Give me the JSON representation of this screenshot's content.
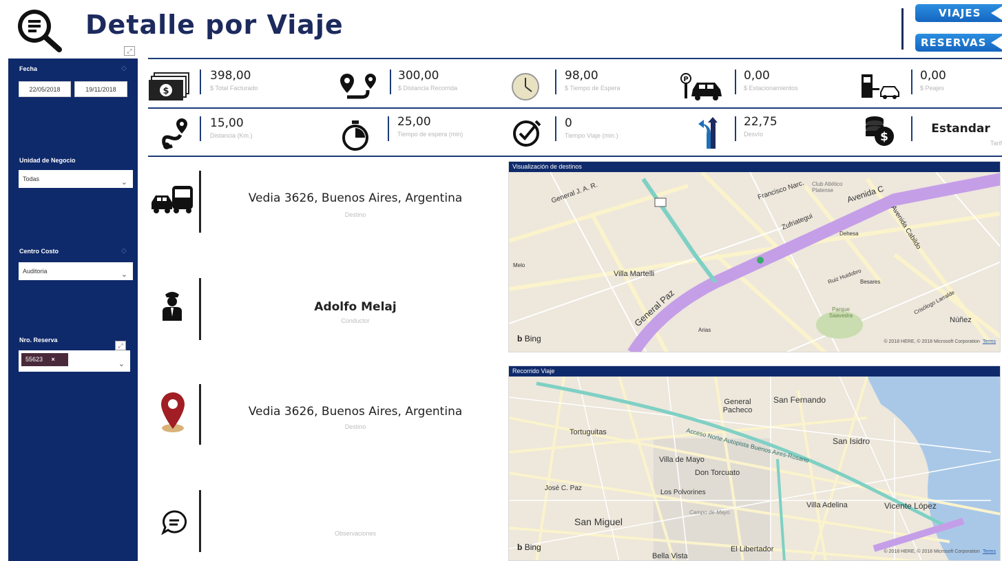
{
  "header": {
    "title": "Detalle por Viaje",
    "nav": {
      "viajes_label": "VIAJES",
      "reservas_label": "RESERVAS"
    }
  },
  "colors": {
    "navy": "#0f2a6b",
    "accent_blue": "#1c3a78",
    "button_blue": "#1f7ad6",
    "tag_bg": "#4a2a3a",
    "route_purple": "#b07be0",
    "pin_red": "#a01e24"
  },
  "sidebar": {
    "fecha_label": "Fecha",
    "date_from": "22/05/2018",
    "date_to": "19/11/2018",
    "unidad_label": "Unidad de Negocio",
    "unidad_value": "Todas",
    "centro_label": "Centro Costo",
    "centro_value": "Auditoria",
    "reserva_label": "Nro. Reserva",
    "reserva_tag": "55623",
    "reserva_tag_remove": "×"
  },
  "kpis_row1": [
    {
      "value": "398,00",
      "label": "$ Total Facturado",
      "icon": "money-icon"
    },
    {
      "value": "300,00",
      "label": "$ Distancia Recorrida",
      "icon": "route-icon"
    },
    {
      "value": "98,00",
      "label": "$ Tiempo de Espera",
      "icon": "clock-icon"
    },
    {
      "value": "0,00",
      "label": "$ Estacionamientos",
      "icon": "parking-icon"
    },
    {
      "value": "0,00",
      "label": "$ Peajes",
      "icon": "toll-icon"
    }
  ],
  "kpis_row2": [
    {
      "value": "15,00",
      "label": "Distancia (Km.)",
      "icon": "distance-icon"
    },
    {
      "value": "25,00",
      "label": "Tiempo de espera (min)",
      "icon": "stopwatch-icon"
    },
    {
      "value": "0",
      "label": "Tiempo Viaje (min.)",
      "icon": "timer-check-icon"
    },
    {
      "value": "22,75",
      "label": "Desvío",
      "icon": "detour-icon"
    },
    {
      "value": "Estandar",
      "label": "Tarifa",
      "icon": "coins-icon"
    }
  ],
  "details": {
    "origen_value": "Vedia 3626, Buenos Aires, Argentina",
    "origen_label": "Destino",
    "conductor_value": "Adolfo Melaj",
    "conductor_label": "Conductor",
    "destino_value": "Vedia 3626, Buenos Aires, Argentina",
    "destino_label": "Destino",
    "obs_label": "Observaciones"
  },
  "map1": {
    "title": "Visualización de destinos",
    "labels": [
      "General J. A. R.",
      "Francisco Narc.",
      "Club Atlético Platense",
      "Avenida C",
      "Avenida Cabildo",
      "Zufriategui",
      "Dehesa",
      "Villa Martelli",
      "General Paz",
      "Núñez",
      "Parque Saavedra",
      "Ruiz Huidobro",
      "Crisólogo Larralde",
      "Melo",
      "Arias",
      "Besares"
    ],
    "bing": "Bing",
    "credits": "© 2018 HERE, © 2018 Microsoft Corporation",
    "terms": "Terms"
  },
  "map2": {
    "title": "Recorrido Viaje",
    "labels": [
      "General Pacheco",
      "San Fernando",
      "Tortuguitas",
      "San Isidro",
      "Villa de Mayo",
      "Don Torcuato",
      "José C. Paz",
      "Los Polvorines",
      "Campo de Mayo",
      "Villa Adelina",
      "Vicente López",
      "San Miguel",
      "El Libertador",
      "Bella Vista",
      "Acceso Norte Autopista Buenos Aires-Rosario"
    ],
    "bing": "Bing",
    "credits": "© 2018 HERE, © 2018 Microsoft Corporation",
    "terms": "Terms"
  }
}
